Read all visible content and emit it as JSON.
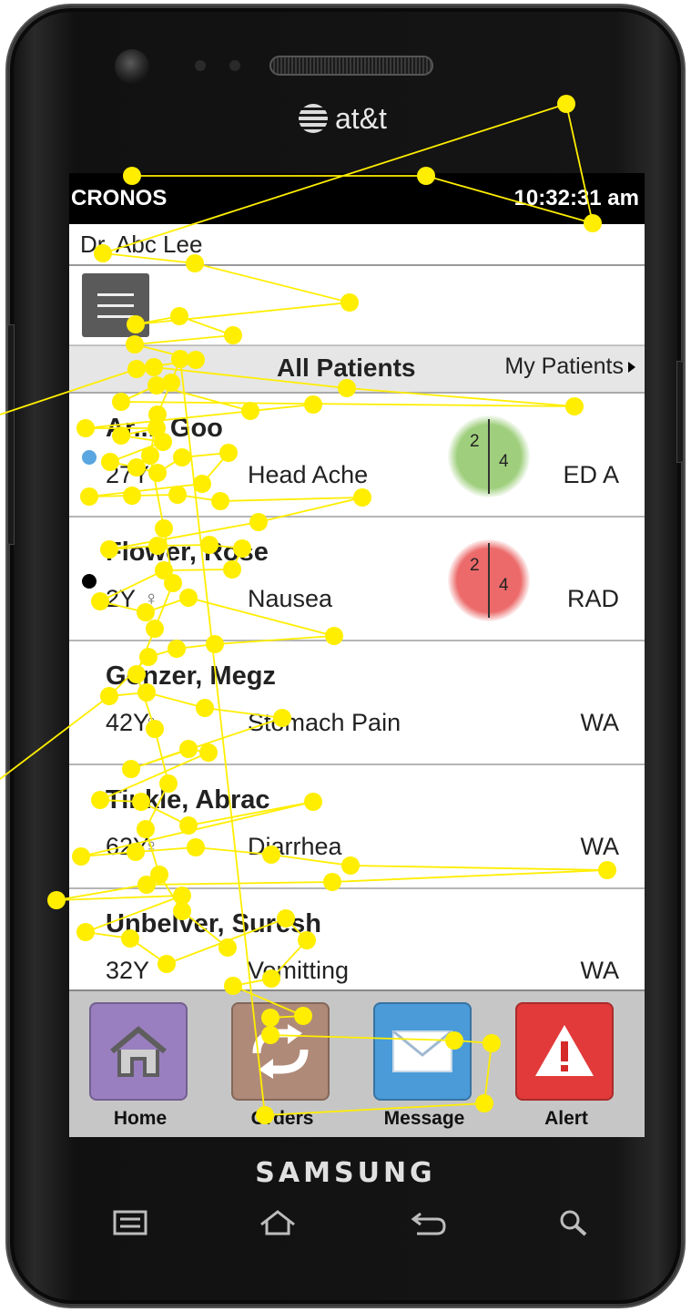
{
  "device": {
    "carrier": "at&t",
    "brand": "SAMSUNG"
  },
  "app": {
    "name": "CRONOS",
    "time": "10:32:31 am",
    "doctor": "Dr. Abc Lee"
  },
  "tabs": {
    "active": "All Patients",
    "other": "My Patients"
  },
  "patients": [
    {
      "name": "Ar..., Goo",
      "age": "27Y",
      "gender": "",
      "complaint": "Head Ache",
      "dept": "ED A",
      "dot": "#5aa6e0",
      "counts": [
        "2",
        "4"
      ],
      "status_color": "#9fcf7d"
    },
    {
      "name": "Flower, Rose",
      "age": "2Y",
      "gender": "♀",
      "complaint": "Nausea",
      "dept": "RAD",
      "dot": "#000000",
      "counts": [
        "2",
        "4"
      ],
      "status_color": "#ec6a6a"
    },
    {
      "name": "Gonzer, Megz",
      "age": "42Y",
      "gender": "♀",
      "complaint": "Stomach Pain",
      "dept": "WA",
      "dot": "",
      "counts": [],
      "status_color": ""
    },
    {
      "name": "Tinkle, Abrac",
      "age": "62Y",
      "gender": "♀",
      "complaint": "Diarrhea",
      "dept": "WA",
      "dot": "",
      "counts": [],
      "status_color": ""
    },
    {
      "name": "Unbelver, Suresh",
      "age": "32Y",
      "gender": "",
      "complaint": "Vomitting",
      "dept": "WA",
      "dot": "",
      "counts": [],
      "status_color": ""
    }
  ],
  "nav": [
    {
      "label": "Home",
      "icon": "home-icon",
      "color": "#9a7fc0"
    },
    {
      "label": "Orders",
      "icon": "refresh-icon",
      "color": "#b08a78"
    },
    {
      "label": "Message",
      "icon": "envelope-icon",
      "color": "#4a9bd8"
    },
    {
      "label": "Alert",
      "icon": "alert-icon",
      "color": "#e23a3a"
    }
  ],
  "overlay": {
    "gaze_color": "#ffee00"
  }
}
